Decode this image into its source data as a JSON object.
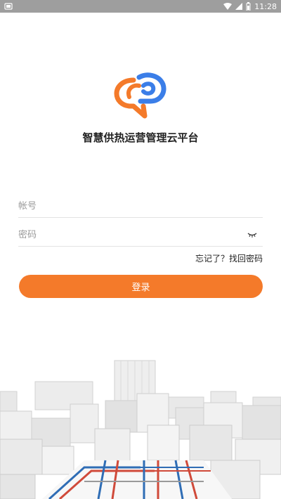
{
  "status_bar": {
    "time": "11:28"
  },
  "app": {
    "title": "智慧供热运营管理云平台"
  },
  "form": {
    "account_placeholder": "帐号",
    "password_placeholder": "密码",
    "forgot_label": "忘记了？找回密码",
    "login_label": "登录"
  },
  "colors": {
    "accent": "#f47a2a",
    "logo_blue": "#3b7ee8",
    "logo_orange": "#f47a2a"
  }
}
